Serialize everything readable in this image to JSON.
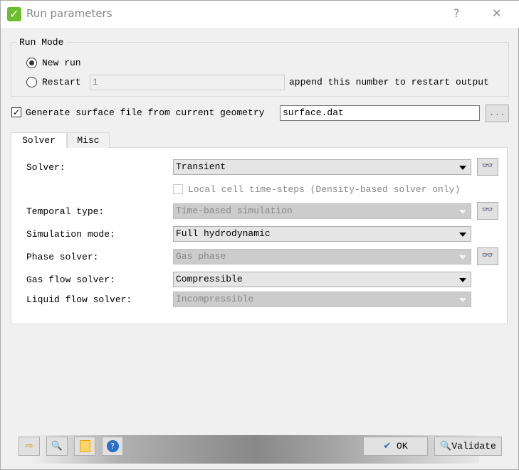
{
  "window": {
    "title": "Run parameters",
    "help": "?",
    "close": "✕"
  },
  "run_mode": {
    "label": "Run Mode",
    "new_run": "New run",
    "restart": "Restart",
    "restart_value": "1",
    "restart_hint": "append this number to restart output",
    "selected": "New run"
  },
  "surface": {
    "label": "Generate surface file from current geometry",
    "checked": true,
    "value": "surface.dat",
    "browse": "..."
  },
  "tabs": [
    {
      "label": "Solver",
      "active": true
    },
    {
      "label": "Misc",
      "active": false
    }
  ],
  "solver": {
    "solver_label": "Solver:",
    "solver_value": "Transient",
    "local_cell": "Local cell time-steps (Density-based solver only)",
    "temporal_label": "Temporal type:",
    "temporal_value": "Time-based simulation",
    "simulation_label": "Simulation mode:",
    "simulation_value": "Full hydrodynamic",
    "phase_label": "Phase solver:",
    "phase_value": "Gas phase",
    "gas_label": "Gas flow solver:",
    "gas_value": "Compressible",
    "liquid_label": "Liquid flow solver:",
    "liquid_value": "Incompressible"
  },
  "footer": {
    "ok": "OK",
    "validate": "Validate"
  }
}
